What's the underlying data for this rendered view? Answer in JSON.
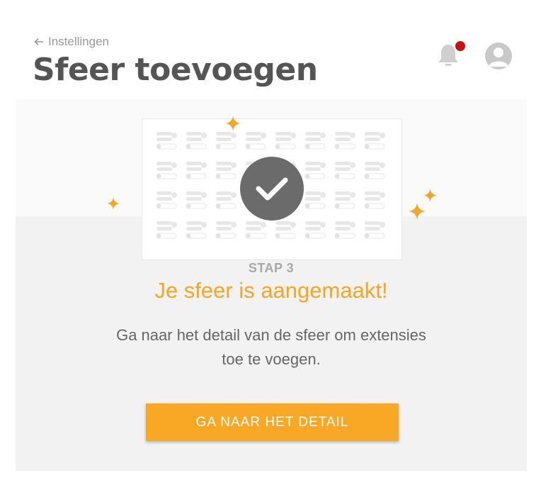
{
  "header": {
    "back_label": "Instellingen",
    "title": "Sfeer toevoegen",
    "notification_badge": true
  },
  "main": {
    "step_label": "STAP 3",
    "success_title": "Je sfeer is aangemaakt!",
    "description": "Ga naar het detail van de sfeer om extensies toe te voegen.",
    "cta_label": "GA NAAR HET DETAIL"
  },
  "icons": [
    "back-arrow-icon",
    "bell-icon",
    "avatar-icon",
    "checkmark-icon",
    "sparkle-icon"
  ],
  "colors": {
    "accent": "#f9a825",
    "title_orange": "#f5a623",
    "badge_red": "#cc1010",
    "text_dark": "#555555",
    "content_bg": "#f2f2f2"
  }
}
